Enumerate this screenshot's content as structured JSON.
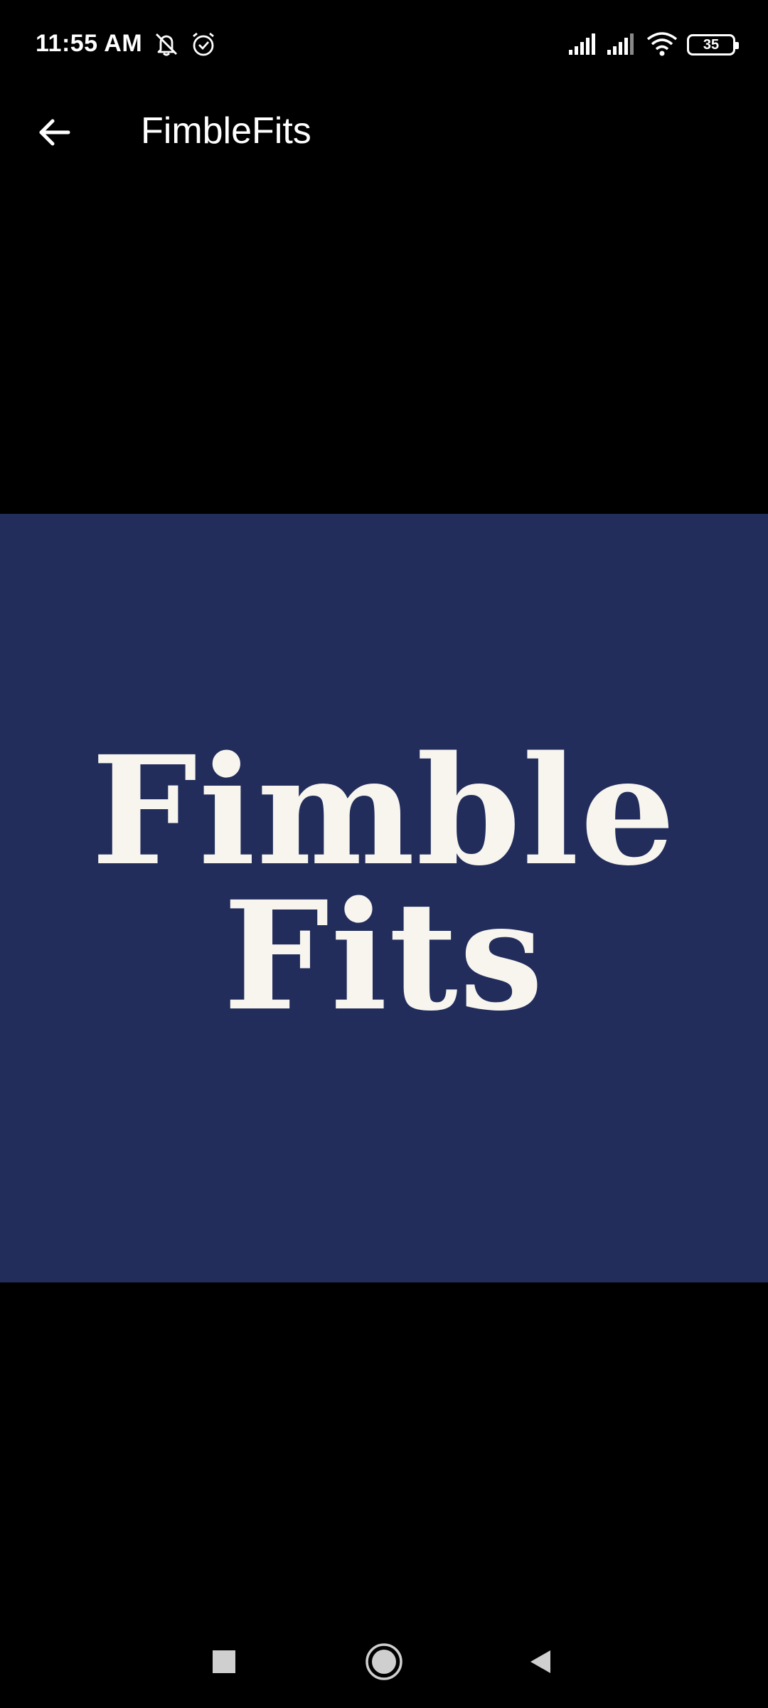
{
  "status_bar": {
    "time": "11:55 AM",
    "battery_level": "35",
    "icons": [
      "mute-icon",
      "alarm-icon",
      "signal-icon",
      "signal-icon",
      "wifi-icon",
      "battery-icon"
    ]
  },
  "app_bar": {
    "title": "FimbleFits",
    "back_icon": "arrow-left-icon"
  },
  "image": {
    "logo_line_1": "Fimble",
    "logo_line_2": "Fits",
    "background_color": "#222d5c",
    "text_color": "#f7f5ee"
  },
  "nav_bar": {
    "icons": [
      "square-recents-icon",
      "circle-home-icon",
      "triangle-back-icon"
    ]
  }
}
